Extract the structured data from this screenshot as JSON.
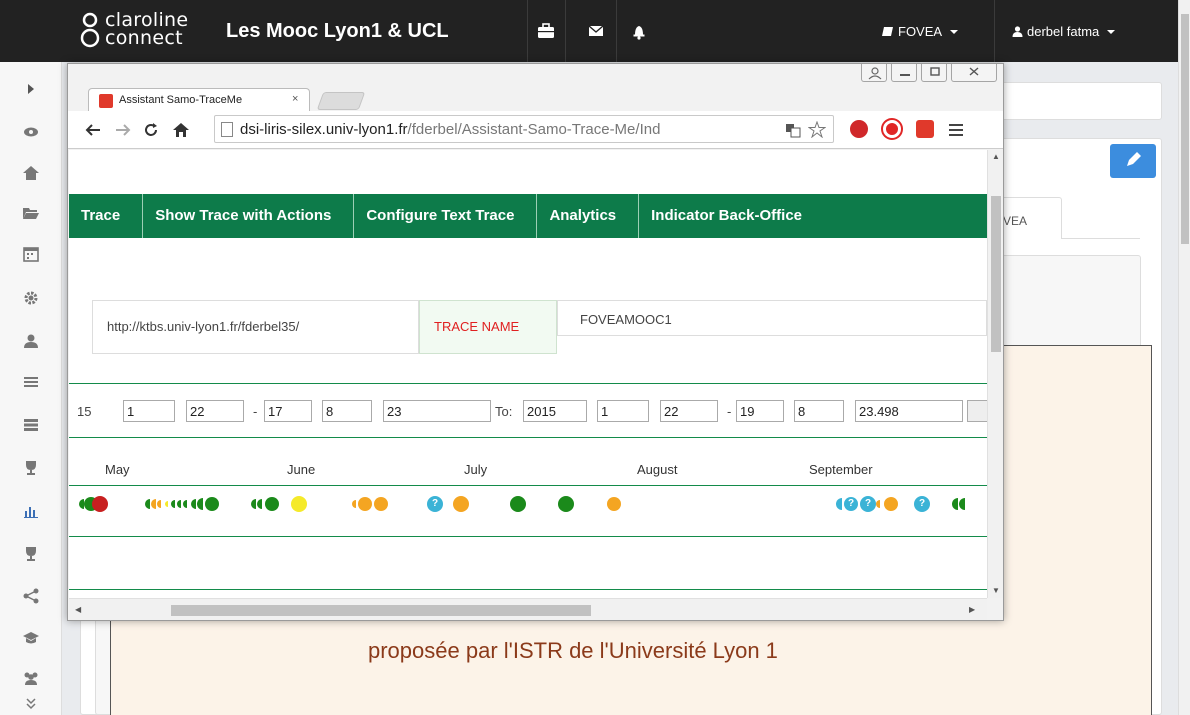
{
  "navbar": {
    "logo_line1": "claroline",
    "logo_line2": "connect",
    "title": "Les Mooc Lyon1 & UCL",
    "workspace_label": "FOVEA",
    "user_label": "derbel fatma"
  },
  "background": {
    "tab_label": "VEA",
    "banner_text": "proposée par l'ISTR de l'Université Lyon 1"
  },
  "popup": {
    "tab_title": "Assistant Samo-TraceMe",
    "tab_close": "×",
    "url_host": "dsi-liris-silex.univ-lyon1.fr",
    "url_path": "/fderbel/Assistant-Samo-Trace-Me/Ind"
  },
  "app": {
    "menu": [
      "Trace",
      "Show Trace with Actions",
      "Configure Text Trace",
      "Analytics",
      "Indicator Back-Office"
    ],
    "base_url": "http://ktbs.univ-lyon1.fr/fderbel35/",
    "trace_name_label": "TRACE NAME",
    "trace_name_value": "FOVEAMOOC1",
    "from": [
      "15",
      "1",
      "22",
      "17",
      "8",
      "23"
    ],
    "to_label": "To:",
    "to": [
      "2015",
      "1",
      "22",
      "19",
      "8",
      "23.498"
    ],
    "months": [
      "May",
      "June",
      "July",
      "August",
      "September"
    ]
  },
  "colors": {
    "menu_green": "#0d7b4a",
    "line_green": "#138b4a",
    "trace_name_red": "#e02020",
    "dot_green": "#1b8a1b",
    "dot_red": "#c82020",
    "dot_orange": "#f4a522",
    "dot_yellow": "#f5ea2a",
    "dot_cyan": "#3bb3d6"
  }
}
